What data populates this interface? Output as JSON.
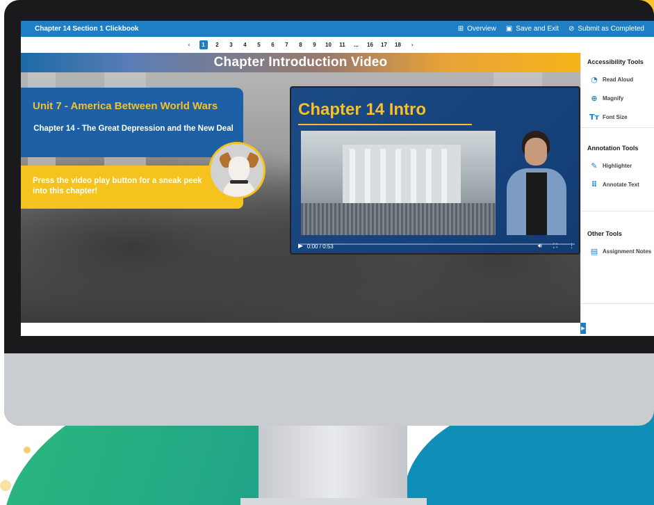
{
  "app": {
    "title": "Chapter 14 Section 1 Clickbook",
    "actions": [
      {
        "icon": "overview-icon",
        "glyph": "⊞",
        "label": "Overview"
      },
      {
        "icon": "save-exit-icon",
        "glyph": "▣",
        "label": "Save and Exit"
      },
      {
        "icon": "submit-check-icon",
        "glyph": "⊘",
        "label": "Submit as Completed"
      }
    ]
  },
  "pager": {
    "prev": "‹",
    "next": "›",
    "pages": [
      "1",
      "2",
      "3",
      "4",
      "5",
      "6",
      "7",
      "8",
      "9",
      "10",
      "11",
      "...",
      "16",
      "17",
      "18"
    ],
    "current": "1"
  },
  "slide": {
    "banner_title": "Chapter Introduction Video",
    "unit_title": "Unit 7 - America Between World Wars",
    "chapter_title": "Chapter 14 - The Great Depression and the New Deal",
    "prompt": "Press the video play button for a sneak peek into this chapter!"
  },
  "video": {
    "title": "Chapter 14 Intro",
    "time": "0:00 / 0:53",
    "progress": 0.0
  },
  "tools": {
    "accessibility": {
      "heading": "Accessibility Tools",
      "items": [
        {
          "icon": "read-aloud-icon",
          "glyph": "◔",
          "label": "Read Aloud"
        },
        {
          "icon": "magnify-icon",
          "glyph": "⊕",
          "label": "Magnify"
        },
        {
          "icon": "font-size-icon",
          "glyph": "Tт",
          "label": "Font Size"
        }
      ]
    },
    "annotation": {
      "heading": "Annotation Tools",
      "items": [
        {
          "icon": "highlighter-icon",
          "glyph": "✎",
          "label": "Highlighter"
        },
        {
          "icon": "annotate-text-icon",
          "glyph": "⠿",
          "label": "Annotate Text"
        }
      ]
    },
    "other": {
      "heading": "Other Tools",
      "items": [
        {
          "icon": "assignment-notes-icon",
          "glyph": "▤",
          "label": "Assignment Notes"
        }
      ]
    }
  },
  "colors": {
    "primary": "#1f7fc4",
    "unit_card": "#1d60a6",
    "accent_yellow": "#f6c31e"
  }
}
